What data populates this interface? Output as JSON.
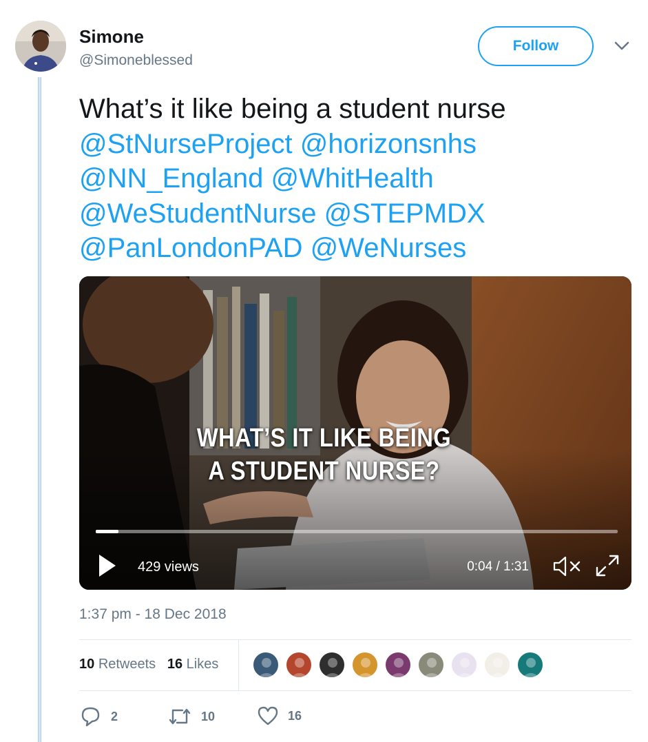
{
  "author": {
    "name": "Simone",
    "handle": "@Simoneblessed",
    "avatar_icon": "user-avatar"
  },
  "follow_label": "Follow",
  "menu_icon": "chevron-down-icon",
  "tweet": {
    "lead_text": "What’s it like being a student nurse",
    "mentions": [
      "@StNurseProject",
      "@horizonsnhs",
      "@NN_England",
      "@WhitHealth",
      "@WeStudentNurse",
      "@STEPMDX",
      "@PanLondonPAD",
      "@WeNurses"
    ],
    "mention_color": "#1da1f2"
  },
  "video": {
    "caption_line1": "WHAT’S IT LIKE BEING",
    "caption_line2": "A STUDENT NURSE?",
    "views": "429 views",
    "time": "0:04 / 1:31",
    "progress": 0.043,
    "play_icon": "play-icon",
    "mute_icon": "muted-speaker-icon",
    "fullscreen_icon": "expand-icon"
  },
  "timestamp": "1:37 pm - 18 Dec 2018",
  "stats": {
    "retweets_count": "10",
    "retweets_label": "Retweets",
    "likes_count": "16",
    "likes_label": "Likes"
  },
  "likers": [
    {
      "color": "#3b5a78"
    },
    {
      "color": "#b5462e"
    },
    {
      "color": "#2e2e2e"
    },
    {
      "color": "#d4952f"
    },
    {
      "color": "#7a3a6e"
    },
    {
      "color": "#8a8a7a"
    },
    {
      "color": "#e8e2f0"
    },
    {
      "color": "#f2efe8"
    },
    {
      "color": "#177a7a"
    }
  ],
  "actions": {
    "reply_count": "2",
    "retweet_count": "10",
    "like_count": "16"
  },
  "colors": {
    "accent": "#1da1f2",
    "muted_text": "#657786",
    "thread_line": "#a8cdef"
  }
}
